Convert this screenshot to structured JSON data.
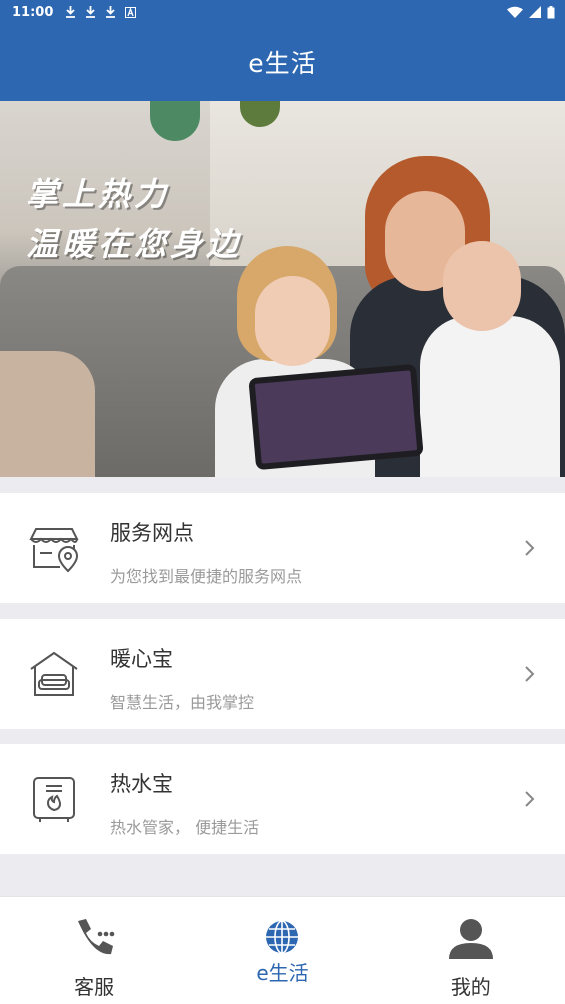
{
  "status": {
    "time": "11:00",
    "notif_icons": [
      "download-icon",
      "download-icon",
      "download-icon",
      "a-icon"
    ],
    "right_icons": [
      "wifi-icon",
      "signal-icon",
      "battery-icon"
    ]
  },
  "header": {
    "title": "e生活"
  },
  "banner": {
    "line1": "掌上热力",
    "line2": "温暖在您身边"
  },
  "services": [
    {
      "title": "服务网点",
      "subtitle": "为您找到最便捷的服务网点",
      "icon": "store-location-icon"
    },
    {
      "title": "暖心宝",
      "subtitle": "智慧生活，由我掌控",
      "icon": "home-sofa-icon"
    },
    {
      "title": "热水宝",
      "subtitle": "热水管家， 便捷生活",
      "icon": "water-heater-icon"
    }
  ],
  "nav": [
    {
      "label": "客服",
      "icon": "phone-icon",
      "active": false
    },
    {
      "label": "e生活",
      "icon": "globe-icon",
      "active": true
    },
    {
      "label": "我的",
      "icon": "user-icon",
      "active": false
    }
  ],
  "colors": {
    "primary": "#2e67b1",
    "icon_gray": "#555555",
    "nav_active": "#2e67b1"
  }
}
